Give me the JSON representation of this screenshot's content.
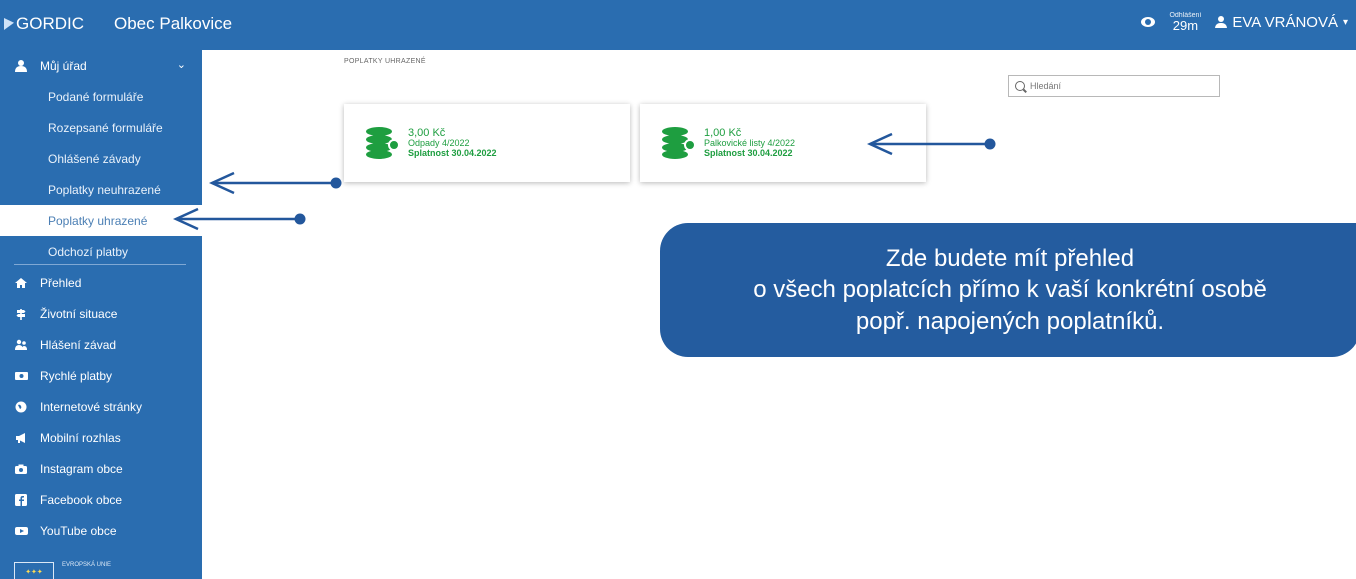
{
  "header": {
    "brand": "GORDIC",
    "org": "Obec Palkovice",
    "logout_label": "Odhlášení",
    "logout_time": "29m",
    "user_name": "EVA VRÁNOVÁ"
  },
  "sidebar": {
    "group": {
      "label": "Můj úřad",
      "icon": "user-icon"
    },
    "subitems": [
      {
        "label": "Podané formuláře"
      },
      {
        "label": "Rozepsané formuláře"
      },
      {
        "label": "Ohlášené závady"
      },
      {
        "label": "Poplatky neuhrazené"
      },
      {
        "label": "Poplatky uhrazené",
        "active": true
      },
      {
        "label": "Odchozí platby"
      }
    ],
    "items": [
      {
        "label": "Přehled",
        "icon": "home-icon"
      },
      {
        "label": "Životní situace",
        "icon": "signpost-icon"
      },
      {
        "label": "Hlášení závad",
        "icon": "report-icon"
      },
      {
        "label": "Rychlé platby",
        "icon": "payment-icon"
      },
      {
        "label": "Internetové stránky",
        "icon": "globe-icon"
      },
      {
        "label": "Mobilní rozhlas",
        "icon": "megaphone-icon"
      },
      {
        "label": "Instagram obce",
        "icon": "camera-icon"
      },
      {
        "label": "Facebook obce",
        "icon": "facebook-icon"
      },
      {
        "label": "YouTube obce",
        "icon": "youtube-icon"
      }
    ],
    "eu_text": "EVROPSKÁ UNIE"
  },
  "main": {
    "title": "POPLATKY UHRAZENÉ",
    "search_placeholder": "Hledání",
    "cards": [
      {
        "amount": "3,00 Kč",
        "desc": "Odpady 4/2022",
        "due": "Splatnost 30.04.2022"
      },
      {
        "amount": "1,00 Kč",
        "desc": "Palkovické listy 4/2022",
        "due": "Splatnost 30.04.2022"
      }
    ]
  },
  "callout": {
    "line1": "Zde budete mít přehled",
    "line2": "o všech poplatcích přímo k vaší konkrétní osobě",
    "line3": "popř. napojených poplatníků."
  },
  "colors": {
    "primary": "#2a6db0",
    "callout": "#245c9f",
    "accent_green": "#1e9e40",
    "arrow": "#23579c"
  }
}
